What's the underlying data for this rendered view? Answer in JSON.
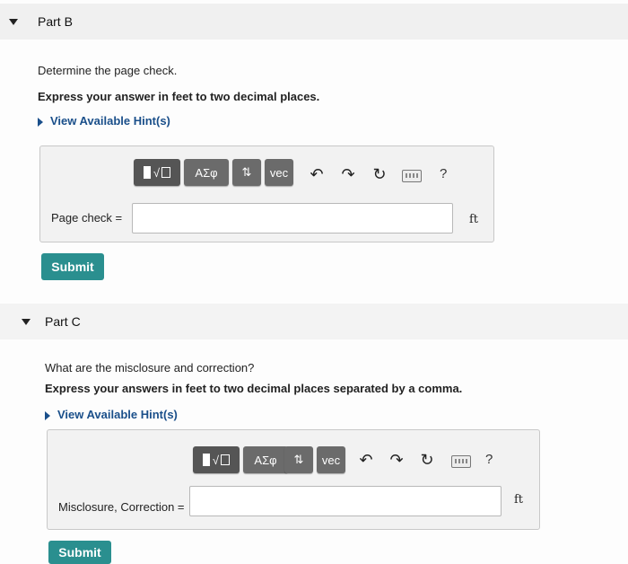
{
  "partB": {
    "title": "Part B",
    "question": "Determine the page check.",
    "instruction": "Express your answer in feet to two decimal places.",
    "hint_link": "View Available Hint(s)",
    "toolbar": {
      "greek": "ΑΣφ",
      "arrows": "⇅",
      "vec": "vec",
      "help": "?"
    },
    "field_label": "Page check =",
    "input_value": "",
    "unit": "ft",
    "submit": "Submit"
  },
  "partC": {
    "title": "Part C",
    "question": "What are the misclosure and correction?",
    "instruction": "Express your answers in feet to two decimal places separated by a comma.",
    "hint_link": "View Available Hint(s)",
    "toolbar": {
      "greek": "ΑΣφ",
      "arrows": "⇅",
      "vec": "vec",
      "help": "?"
    },
    "field_label": "Misclosure, Correction =",
    "input_value": "",
    "unit": "ft",
    "submit": "Submit"
  }
}
